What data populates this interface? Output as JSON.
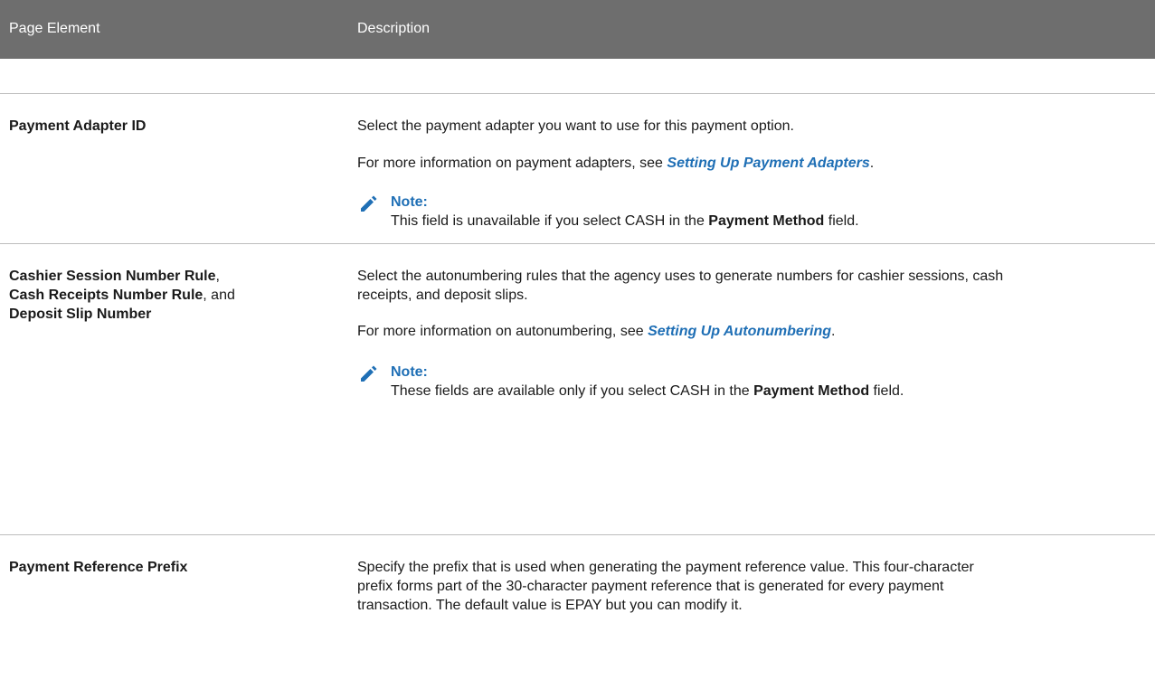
{
  "header": {
    "col1": "Page Element",
    "col2": "Description"
  },
  "rows": [
    {
      "element_label": "Payment Adapter ID",
      "desc1": "Select the payment adapter you want to use for this payment option.",
      "desc2_pre": "For more information on payment adapters, see ",
      "desc2_link": "Setting Up Payment Adapters",
      "desc2_post": ".",
      "note_title": "Note:",
      "note_pre": "This field is unavailable if you select CASH in the ",
      "note_bold": "Payment Method",
      "note_post": " field."
    },
    {
      "element_bold1": "Cashier Session Number Rule",
      "element_sep1": ",",
      "element_bold2": "Cash Receipts Number Rule",
      "element_sep2": ", and",
      "element_bold3": "Deposit Slip Number",
      "desc1": "Select the autonumbering rules that the agency uses to generate numbers for cashier sessions, cash receipts, and deposit slips.",
      "desc2_pre": "For more information on autonumbering, see ",
      "desc2_link": "Setting Up Autonumbering",
      "desc2_post": ".",
      "note_title": "Note:",
      "note_pre": "These fields are available only if you select CASH in the ",
      "note_bold": "Payment Method",
      "note_post": " field."
    },
    {
      "element_label": "Payment Reference Prefix",
      "desc1": "Specify the prefix that is used when generating the payment reference value. This four-character prefix forms part of the 30-character payment reference that is generated for every payment transaction. The default value is EPAY but you can modify it."
    }
  ],
  "icons": {
    "note": "pencil-icon"
  },
  "colors": {
    "header_bg": "#6e6e6e",
    "link": "#1f6fb5"
  }
}
